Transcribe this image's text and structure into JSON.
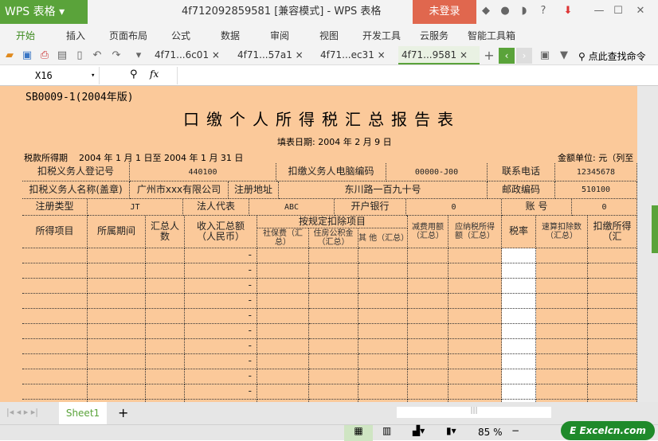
{
  "app": {
    "logo": "WPS 表格",
    "title": "4f712092859581 [兼容模式] - WPS 表格",
    "login": "未登录"
  },
  "menu": [
    "开始",
    "插入",
    "页面布局",
    "公式",
    "数据",
    "审阅",
    "视图",
    "开发工具",
    "云服务",
    "智能工具箱"
  ],
  "doc_tabs": [
    "4f71...6c01",
    "4f71...57a1",
    "4f71...ec31",
    "4f71...9581"
  ],
  "search_label": "点此查找命令",
  "cell_ref": "X16",
  "fx": "fx",
  "sheet": {
    "form_code": "SB0009-1(2004年版)",
    "title": "口缴个人所得税汇总报告表",
    "fill_date": "填表日期:   2004   年 2 月 9 日",
    "period": "税款所得期    2004 年 1 月 1 日至 2004 年 1 月 31 日",
    "unit": "金额单位: 元（列至",
    "r1": [
      "扣税义务人登记号",
      "440100",
      "扣缴义务人电脑编码",
      "00000-J00",
      "联系电话",
      "12345678"
    ],
    "r2": [
      "扣税义务人名称(盖章)",
      "广州市xxx有限公司",
      "注册地址",
      "东川路一百九十号",
      "邮政编码",
      "510100"
    ],
    "r3": [
      "注册类型",
      "JT",
      "法人代表",
      "ABC",
      "开户银行",
      "0",
      "账    号",
      "0"
    ],
    "headers": [
      "所得项目",
      "所属期间",
      "汇总人数",
      "收入汇总额（人民币）",
      "按规定扣除项目",
      "社保费（汇总）",
      "住房公积金（汇总）",
      "其  他（汇总）",
      "减费用额（汇总）",
      "应纳税所得额（汇总）",
      "税率",
      "速算扣除数（汇总）",
      "扣缴所得（汇"
    ],
    "dash": "-"
  },
  "sheet_tabs": [
    "Sheet1"
  ],
  "zoom": "85 %",
  "watermark": "Excelcn.com"
}
